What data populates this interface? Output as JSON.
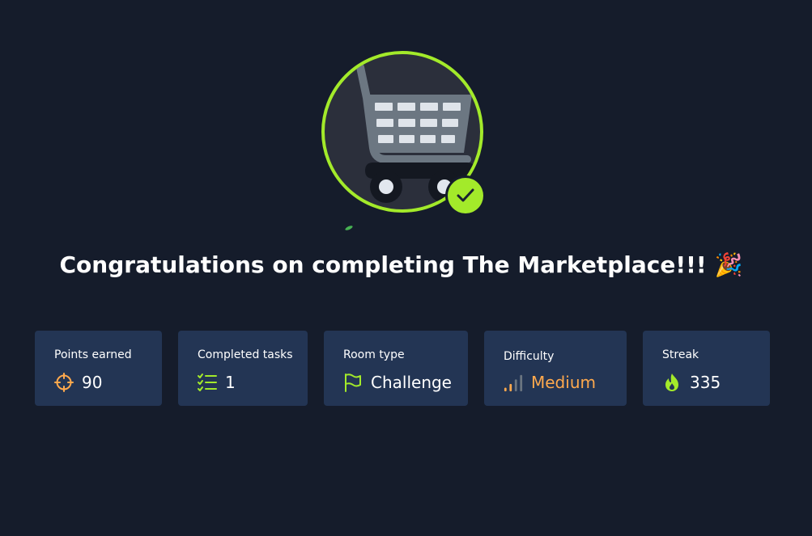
{
  "badge": {
    "icon": "shopping-cart-icon",
    "completed_icon": "check-icon",
    "ring_color": "#a3ea2a"
  },
  "title": {
    "text": "Congratulations on completing The Marketplace!!!",
    "emoji": "🎉"
  },
  "stats": [
    {
      "label": "Points earned",
      "value": "90",
      "icon": "target-icon",
      "icon_color": "#ffa94d"
    },
    {
      "label": "Completed tasks",
      "value": "1",
      "icon": "task-list-icon",
      "icon_color": "#a3ea2a"
    },
    {
      "label": "Room type",
      "value": "Challenge",
      "icon": "flag-icon",
      "icon_color": "#a3ea2a"
    },
    {
      "label": "Difficulty",
      "value": "Medium",
      "icon": "signal-bars-icon",
      "icon_color": "#ffa94d"
    },
    {
      "label": "Streak",
      "value": "335",
      "icon": "flame-icon",
      "icon_color": "#a3ea2a"
    }
  ],
  "colors": {
    "background": "#151c2b",
    "card_background": "#233554",
    "accent_green": "#a3ea2a",
    "accent_orange": "#ffa94d"
  }
}
